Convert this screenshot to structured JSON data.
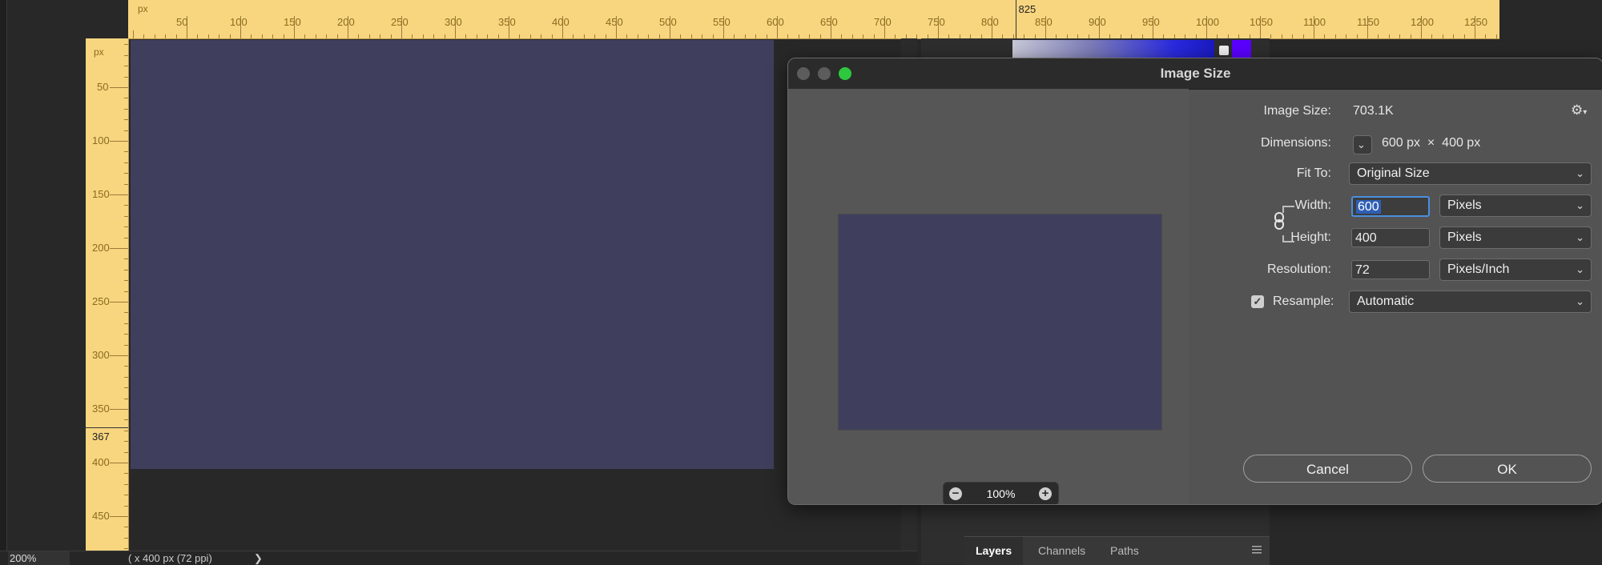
{
  "ruler_top": {
    "unit": "px",
    "labels": [
      "50",
      "100",
      "150",
      "200",
      "250",
      "300",
      "350",
      "400",
      "450",
      "500",
      "550",
      "600",
      "650",
      "700",
      "750",
      "800",
      "850",
      "900",
      "950",
      "1000",
      "1050",
      "1100",
      "1150",
      "1200",
      "1250"
    ],
    "marker_value": "825"
  },
  "ruler_left": {
    "unit": "px",
    "labels": [
      "50",
      "100",
      "150",
      "200",
      "250",
      "300",
      "350",
      "400",
      "450"
    ],
    "marker_value": "367"
  },
  "status_bar": {
    "zoom": "200%",
    "doc_info": "( x 400 px (72 ppi)",
    "arrow": "❯"
  },
  "panels": {
    "tabs": [
      "Layers",
      "Channels",
      "Paths"
    ],
    "active_tab": "Layers"
  },
  "dialog": {
    "title": "Image Size",
    "image_size_label": "Image Size:",
    "image_size_value": "703.1K",
    "dimensions_label": "Dimensions:",
    "dimensions_value": "600 px  ×  400 px",
    "fit_to_label": "Fit To:",
    "fit_to_value": "Original Size",
    "width_label": "Width:",
    "width_value": "600",
    "width_unit": "Pixels",
    "height_label": "Height:",
    "height_value": "400",
    "height_unit": "Pixels",
    "resolution_label": "Resolution:",
    "resolution_value": "72",
    "resolution_unit": "Pixels/Inch",
    "resample_label": "Resample:",
    "resample_checked": true,
    "resample_value": "Automatic",
    "preview_zoom": "100%",
    "cancel_label": "Cancel",
    "ok_label": "OK"
  },
  "colors": {
    "ruler": "#f8d67f",
    "canvas": "#3f3f5d",
    "focus": "#4a8fe0"
  }
}
